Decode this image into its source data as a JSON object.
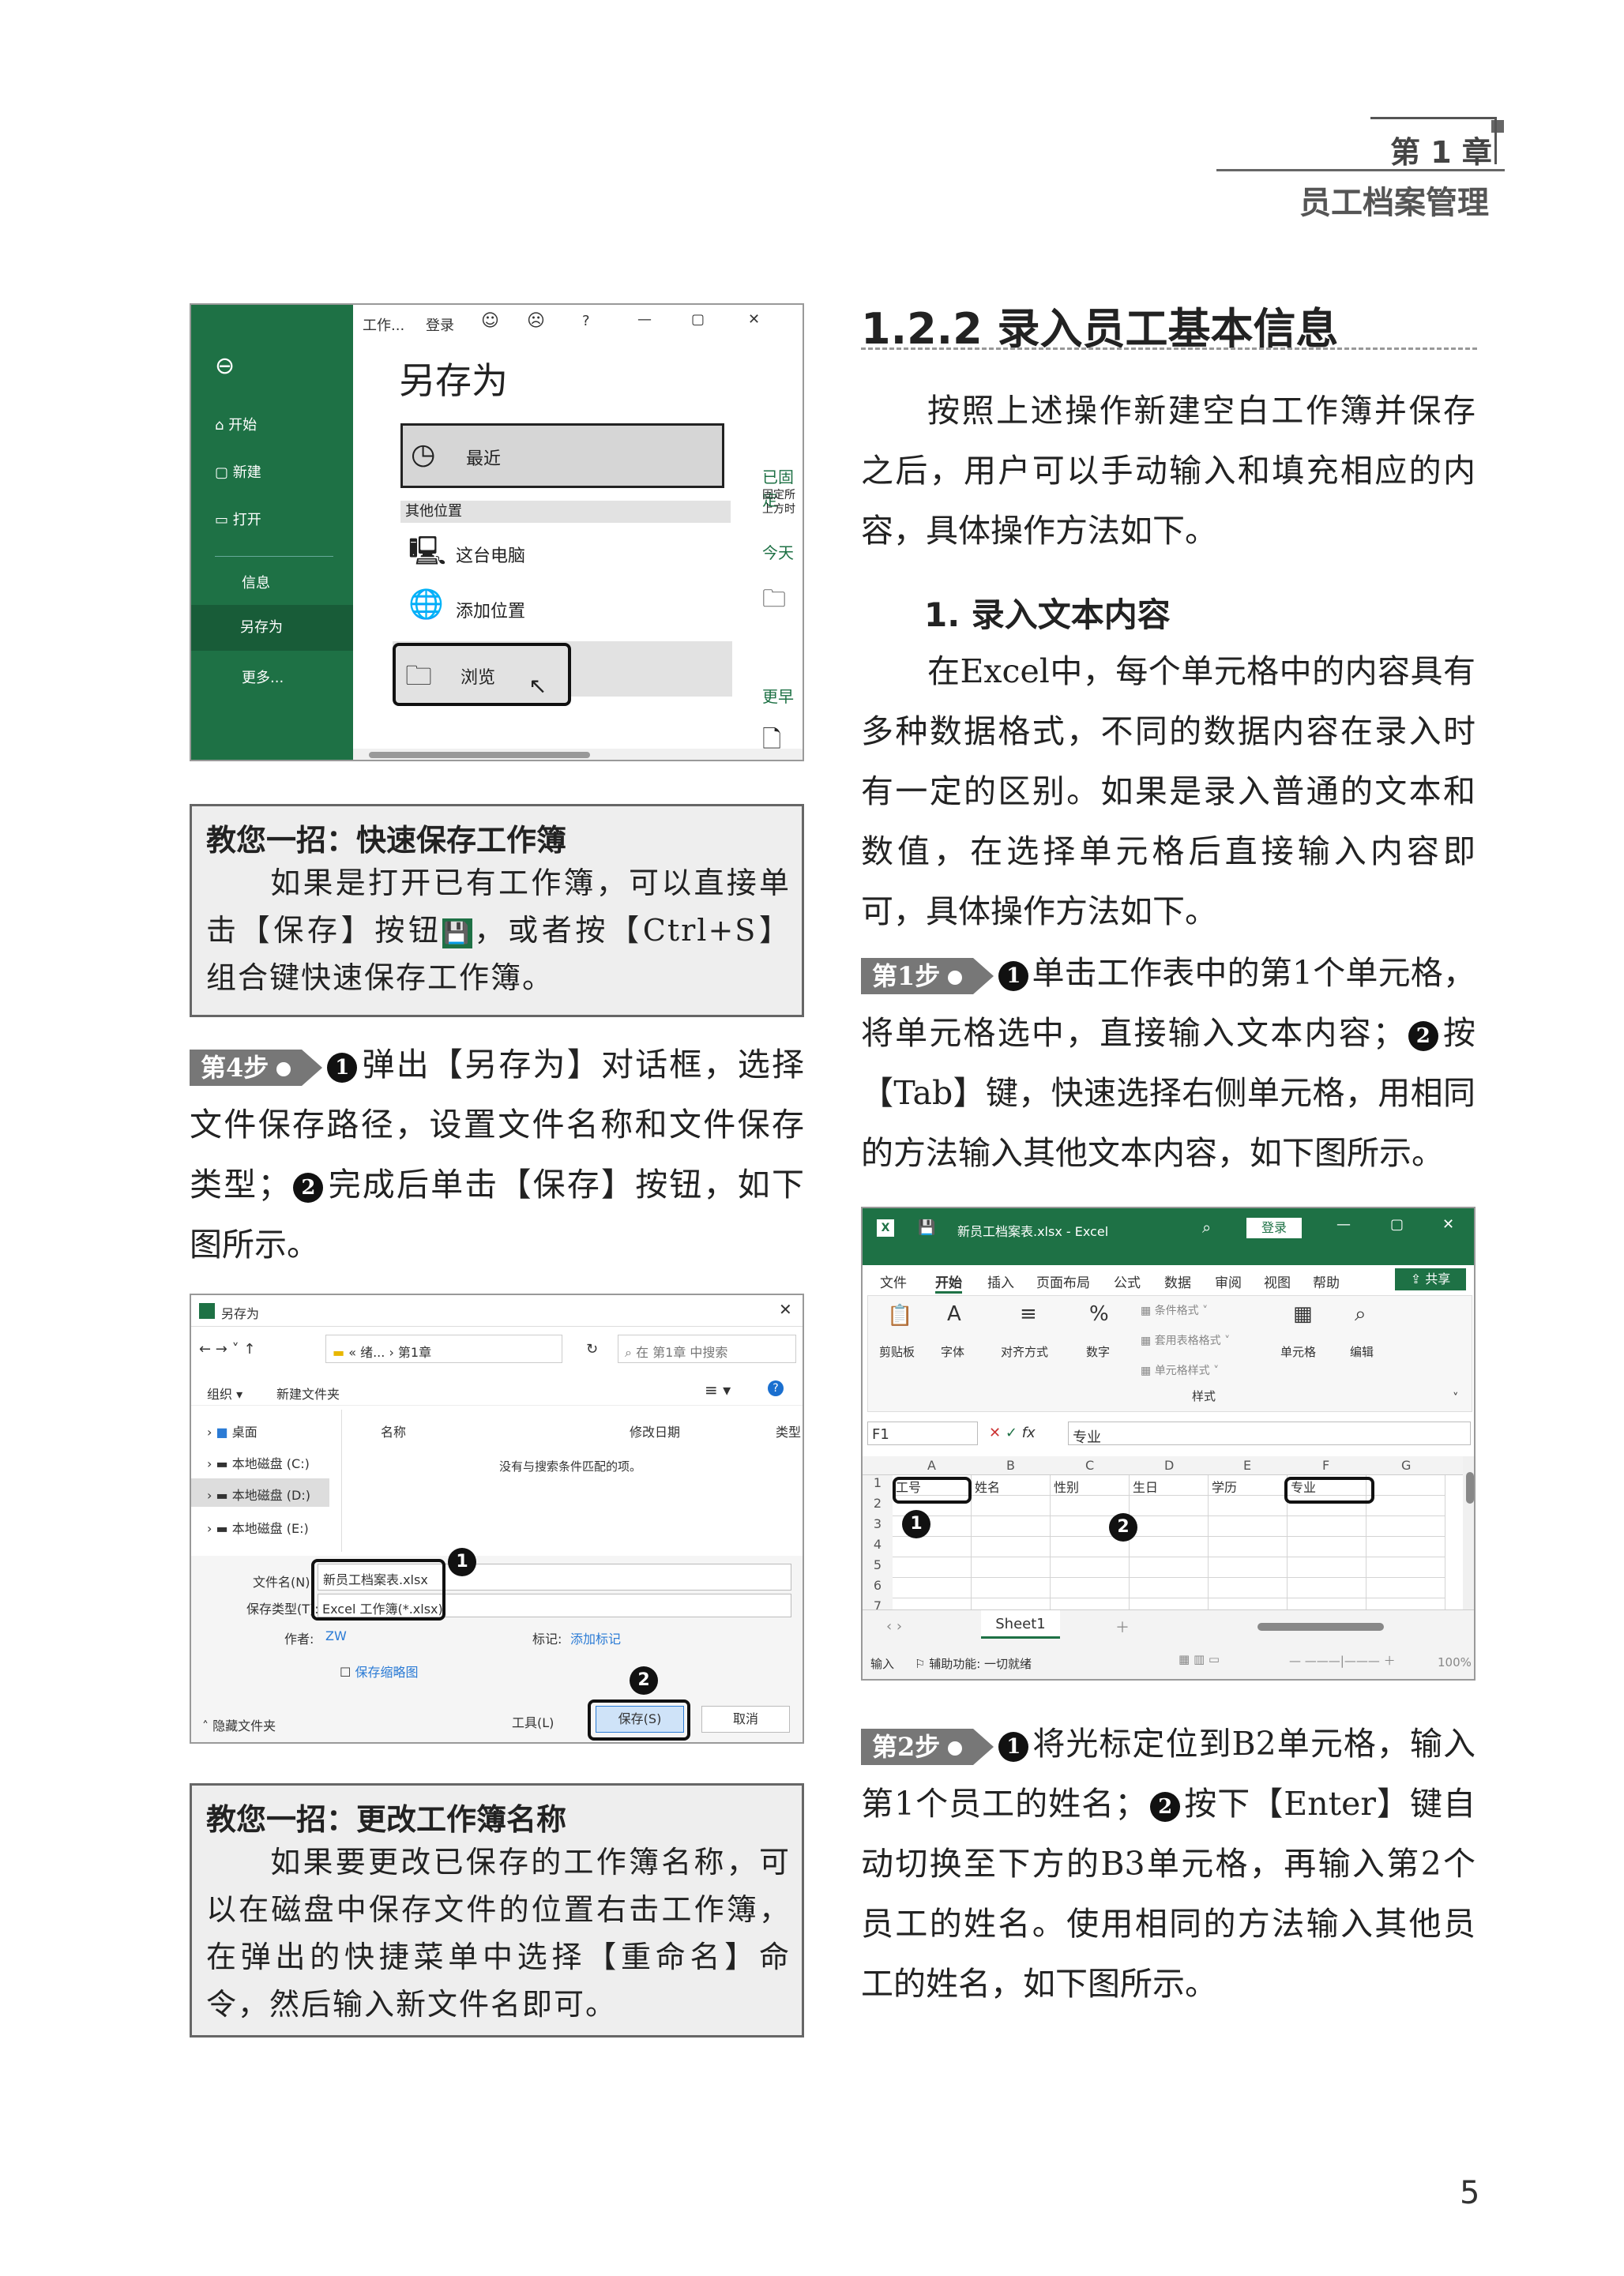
{
  "header": {
    "chapter": "第 1 章",
    "subtitle": "员工档案管理"
  },
  "page_number": "5",
  "screenshot_saveas": {
    "window_title": "工作...",
    "login": "登录",
    "help": "?",
    "heading": "另存为",
    "sidebar": [
      "开始",
      "新建",
      "打开",
      "信息",
      "另存为",
      "更多..."
    ],
    "recent": "最近",
    "other_locations": "其他位置",
    "this_pc": "这台电脑",
    "add_location": "添加位置",
    "browse": "浏览",
    "right_col": [
      "已固定",
      "固定所",
      "上方时",
      "今天",
      "更早"
    ]
  },
  "tip1": {
    "title": "教您一招：快速保存工作簿",
    "body": "如果是打开已有工作簿，可以直接单击【保存】按钮",
    "body2": "，或者按【Ctrl+S】组合键快速保存工作簿。"
  },
  "step4": {
    "tag": "第4步",
    "text1": "弹出【另存为】对话框，选择文件保存路径，设置文件名称和文件保存类型；",
    "text2": "完成后单击【保存】按钮，如下图所示。"
  },
  "screenshot_dialog": {
    "title": "另存为",
    "path": "« 绪... › 第1章",
    "search": "在 第1章 中搜索",
    "organize": "组织 ▾",
    "new_folder": "新建文件夹",
    "tree": [
      "桌面",
      "本地磁盘 (C:)",
      "本地磁盘 (D:)",
      "本地磁盘 (E:)"
    ],
    "col_name": "名称",
    "col_date": "修改日期",
    "col_type": "类型",
    "empty": "没有与搜索条件匹配的项。",
    "filename_label": "文件名(N):",
    "filename": "新员工档案表.xlsx",
    "filetype_label": "保存类型(T):",
    "filetype": "Excel 工作簿(*.xlsx)",
    "author_label": "作者:",
    "author": "ZW",
    "tag_label": "标记:",
    "tag": "添加标记",
    "thumb": "保存缩略图",
    "hide": "隐藏文件夹",
    "tools": "工具(L)",
    "save": "保存(S)",
    "cancel": "取消",
    "n1": "1",
    "n2": "2"
  },
  "tip2": {
    "title": "教您一招：更改工作簿名称",
    "body": "如果要更改已保存的工作簿名称，可以在磁盘中保存文件的位置右击工作簿，在弹出的快捷菜单中选择【重命名】命令，然后输入新文件名即可。"
  },
  "section": {
    "title": "1.2.2  录入员工基本信息",
    "intro": "按照上述操作新建空白工作簿并保存之后，用户可以手动输入和填充相应的内容，具体操作方法如下。"
  },
  "sub1": {
    "title": "1. 录入文本内容",
    "body": "在Excel中，每个单元格中的内容具有多种数据格式，不同的数据内容在录入时有一定的区别。如果是录入普通的文本和数值，在选择单元格后直接输入内容即可，具体操作方法如下。"
  },
  "step1": {
    "tag": "第1步",
    "text1": "单击工作表中的第1个单元格，将单元格选中，直接输入文本内容；",
    "text2": "按【Tab】键，快速选择右侧单元格，用相同的方法输入其他文本内容，如下图所示。"
  },
  "screenshot_excel": {
    "file": "新员工档案表.xlsx - Excel",
    "login": "登录",
    "tabs": [
      "文件",
      "开始",
      "插入",
      "页面布局",
      "公式",
      "数据",
      "审阅",
      "视图",
      "帮助"
    ],
    "share": "共享",
    "ribbon": [
      "剪贴板",
      "字体",
      "对齐方式",
      "数字",
      "单元格",
      "编辑"
    ],
    "styles": [
      "条件格式 ˅",
      "套用表格格式 ˅",
      "单元格样式 ˅"
    ],
    "styles_label": "样式",
    "namebox": "F1",
    "formula": "专业",
    "cols": [
      "A",
      "B",
      "C",
      "D",
      "E",
      "F",
      "G"
    ],
    "rows": [
      "1",
      "2",
      "3",
      "4",
      "5",
      "6",
      "7"
    ],
    "row1": [
      "工号",
      "姓名",
      "性别",
      "生日",
      "学历",
      "专业"
    ],
    "sheet": "Sheet1",
    "status": "输入",
    "access": "辅助功能: 一切就绪",
    "zoom": "100%",
    "n1": "1",
    "n2": "2"
  },
  "step2": {
    "tag": "第2步",
    "text1": "将光标定位到B2单元格，输入第1个员工的姓名；",
    "text2": "按下【Enter】键自动切换至下方的B3单元格，再输入第2个员工的姓名。使用相同的方法输入其他员工的姓名，如下图所示。"
  },
  "nums": {
    "one": "1",
    "two": "2"
  }
}
